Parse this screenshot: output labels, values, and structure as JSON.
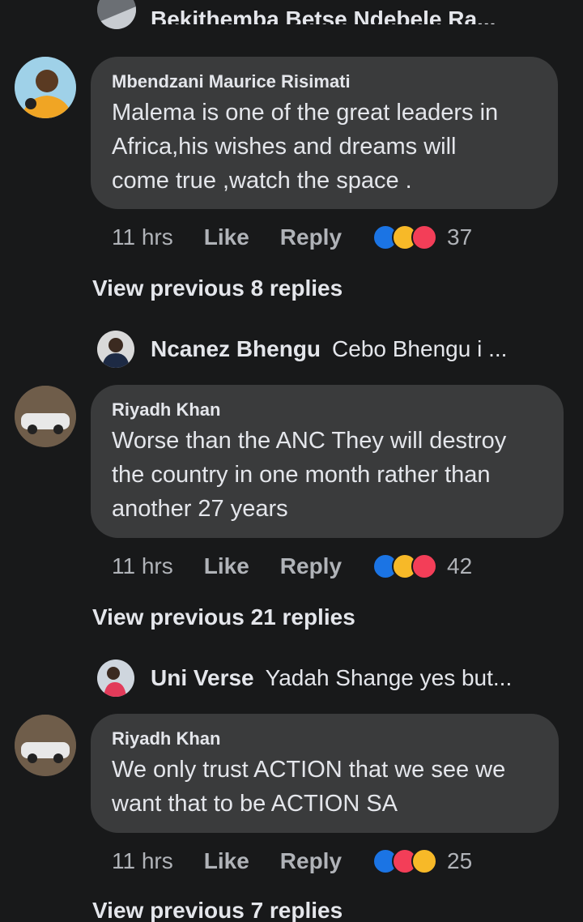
{
  "top_reply": {
    "text": "Bekithemba Betse Ndebele Ra..."
  },
  "comments": [
    {
      "author": "Mbendzani Maurice Risimati",
      "lines": [
        "Malema is one of the great leaders in",
        "Africa,his wishes and dreams will",
        "come true ,watch the space ."
      ],
      "time": "11 hrs",
      "like": "Like",
      "reply": "Reply",
      "reactions": [
        "like",
        "haha",
        "love"
      ],
      "count": "37"
    },
    {
      "author": "Riyadh Khan",
      "lines": [
        "Worse than the ANC They will destroy",
        "the country in one month rather than",
        "another 27 years"
      ],
      "time": "11 hrs",
      "like": "Like",
      "reply": "Reply",
      "reactions": [
        "like",
        "haha",
        "love"
      ],
      "count": "42"
    },
    {
      "author": "Riyadh Khan",
      "lines": [
        "We only trust ACTION that we see we",
        "want that to be ACTION SA"
      ],
      "time": "11 hrs",
      "like": "Like",
      "reply": "Reply",
      "reactions": [
        "like",
        "love",
        "haha"
      ],
      "count": "25"
    }
  ],
  "view_previous": [
    "View previous 8 replies",
    "View previous 21 replies",
    "View previous 7 replies"
  ],
  "replies": [
    {
      "name": "Ncanez Bhengu",
      "snippet": "Cebo Bhengu i ..."
    },
    {
      "name": "Uni Verse",
      "snippet": "Yadah Shange yes but..."
    }
  ],
  "colors": {
    "background": "#18191a",
    "bubble": "#3a3b3c",
    "like": "#1b74e4",
    "haha": "#f7b928",
    "love": "#f33e58"
  }
}
